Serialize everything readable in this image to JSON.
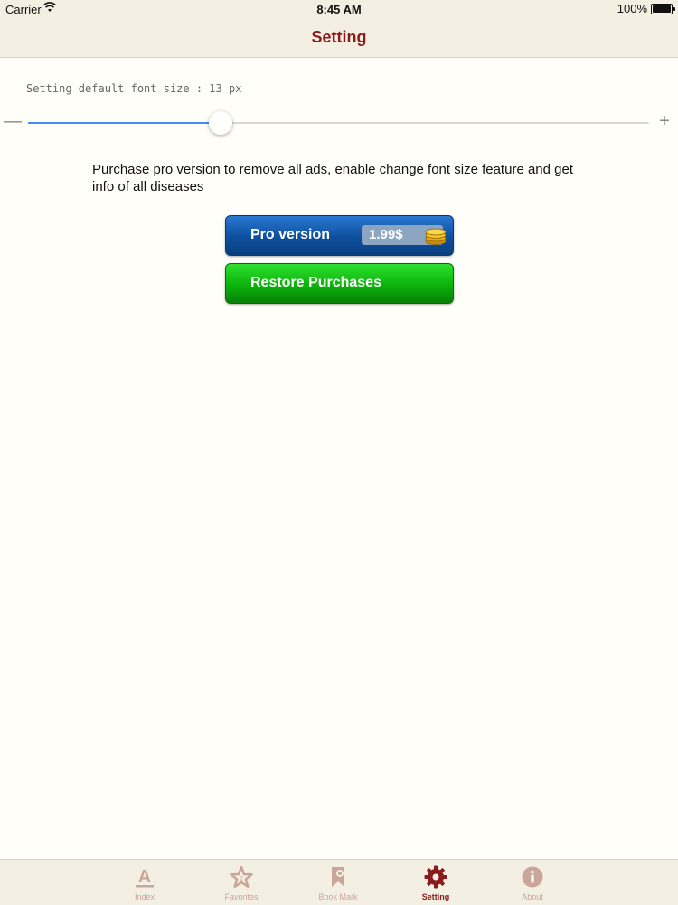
{
  "status_bar": {
    "carrier": "Carrier",
    "time": "8:45 AM",
    "battery": "100%"
  },
  "nav": {
    "title": "Setting"
  },
  "font_setting": {
    "label": "Setting default font size : 13 px",
    "slider_value_fraction": 0.31
  },
  "promo": {
    "text": "Purchase pro version to remove all ads, enable change font size feature and get info of all diseases"
  },
  "buttons": {
    "pro_label": "Pro version",
    "pro_price": "1.99$",
    "restore_label": "Restore Purchases"
  },
  "tabs": [
    {
      "label": "Index",
      "icon": "letter-a-icon",
      "active": false
    },
    {
      "label": "Favorites",
      "icon": "star-icon",
      "active": false
    },
    {
      "label": "Book Mark",
      "icon": "bookmark-icon",
      "active": false
    },
    {
      "label": "Setting",
      "icon": "gear-icon",
      "active": true
    },
    {
      "label": "About",
      "icon": "info-icon",
      "active": false
    }
  ],
  "colors": {
    "accent": "#8b1a1a",
    "tab_inactive": "#c9a59a",
    "slider_fill": "#3f8ef2"
  }
}
